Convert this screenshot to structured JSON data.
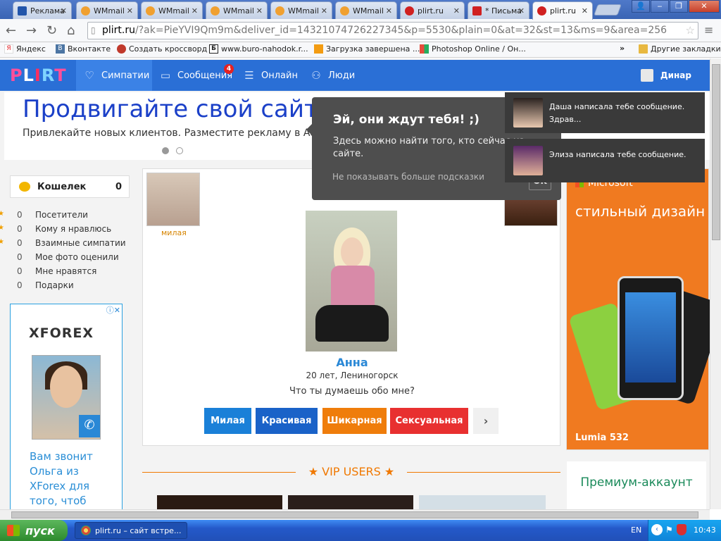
{
  "tabs": [
    {
      "label": "Реклама"
    },
    {
      "label": "WMmail"
    },
    {
      "label": "WMmail"
    },
    {
      "label": "WMmail"
    },
    {
      "label": "WMmail"
    },
    {
      "label": "WMmail"
    },
    {
      "label": "plirt.ru"
    },
    {
      "label": "* Письма"
    },
    {
      "label": "plirt.ru"
    }
  ],
  "url": {
    "domain": "plirt.ru",
    "rest": "/?ak=PieYVI9Qm9m&deliver_id=14321074726227345&p=5530&plain=0&at=32&st=13&ms=9&area=256"
  },
  "bookmarks": [
    {
      "label": "Яндекс",
      "icon": "yandex-icon",
      "color": "#e31e24"
    },
    {
      "label": "Вконтакте",
      "icon": "vk-icon",
      "color": "#4c75a3"
    },
    {
      "label": "Создать кроссворд",
      "icon": "ladybug-icon",
      "color": "#c0392b"
    },
    {
      "label": "www.buro-nahodok.r...",
      "icon": "b-icon",
      "color": "#222"
    },
    {
      "label": "Загрузка завершена ...",
      "icon": "download-icon",
      "color": "#f39c12"
    },
    {
      "label": "Photoshop Online / Он...",
      "icon": "photoshop-icon",
      "color": "#2d63c8"
    },
    {
      "label": "Другие закладки",
      "icon": "folder-icon",
      "color": "#e8b840"
    }
  ],
  "nav": {
    "logo": "PLIRT",
    "items": [
      {
        "label": "Симпатии",
        "icon": "heart-icon",
        "selected": true
      },
      {
        "label": "Сообщения",
        "icon": "message-icon",
        "badge": "4"
      },
      {
        "label": "Онлайн",
        "icon": "list-icon"
      },
      {
        "label": "Люди",
        "icon": "people-icon"
      }
    ],
    "user": "Динар"
  },
  "ad": {
    "headline": "Продвигайте свой сайт",
    "sub": "Привлекайте новых клиентов. Разместите рекламу в AdWords"
  },
  "wallet": {
    "label": "Кошелек",
    "value": "0"
  },
  "stats": [
    {
      "count": "0",
      "label": "Посетители",
      "star": true
    },
    {
      "count": "0",
      "label": "Кому я нравлюсь",
      "star": true
    },
    {
      "count": "0",
      "label": "Взаимные симпатии",
      "star": true
    },
    {
      "count": "0",
      "label": "Мое фото оценили",
      "star": false
    },
    {
      "count": "0",
      "label": "Мне нравятся",
      "star": false
    },
    {
      "count": "0",
      "label": "Подарки",
      "star": false
    }
  ],
  "leftad": {
    "brand": "XFOREX",
    "text": "Вам звонит Ольга из XForex для того, чтоб"
  },
  "thumb_label": "милая",
  "profile": {
    "name": "Анна",
    "age": "20 лет, Лениногорск",
    "question": "Что ты думаешь обо мне?"
  },
  "ratings": [
    {
      "label": "Милая",
      "color": "#1a80d8"
    },
    {
      "label": "Красивая",
      "color": "#1a62c8"
    },
    {
      "label": "Шикарная",
      "color": "#ef7d0b"
    },
    {
      "label": "Сексуальная",
      "color": "#e83030"
    }
  ],
  "vip": "VIP USERS",
  "rightad": {
    "brand": "Microsoft",
    "slogan": "стильный дизайн",
    "product": "Lumia 532"
  },
  "premium": "Премиум-аккаунт",
  "tip": {
    "title": "Эй, они ждут тебя! ;)",
    "body": "Здесь можно найти того, кто сейчас на сайте.",
    "dismiss": "Не показывать больше подсказки",
    "ok": "OK"
  },
  "notifications": [
    {
      "text": "Даша написала тебе сообщение. Здрав..."
    },
    {
      "text": "Элиза написала тебе сообщение."
    }
  ],
  "taskbar": {
    "start": "пуск",
    "task": "plirt.ru – сайт встре...",
    "lang": "EN",
    "time": "10:43"
  }
}
